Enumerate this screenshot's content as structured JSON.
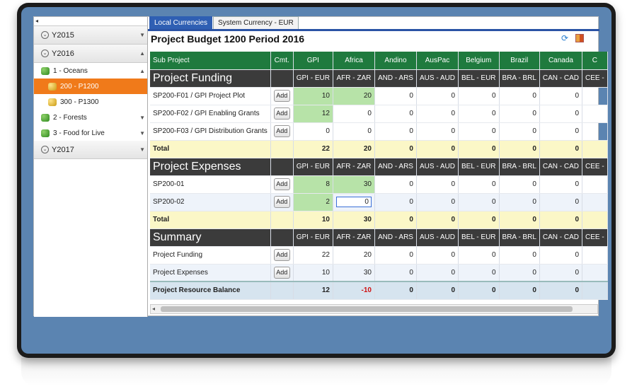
{
  "sidebar": {
    "collapse_glyph": "◂",
    "years": [
      {
        "label": "Y2015",
        "expanded": false
      },
      {
        "label": "Y2016",
        "expanded": true
      },
      {
        "label": "Y2017",
        "expanded": false
      }
    ],
    "nodes": [
      {
        "label": "1 - Oceans",
        "icon": "green-coins-icon",
        "level": 1,
        "selected": false
      },
      {
        "label": "200 - P1200",
        "icon": "gold-coins-icon",
        "level": 2,
        "selected": true
      },
      {
        "label": "300 - P1300",
        "icon": "gold-coins-icon",
        "level": 2,
        "selected": false
      },
      {
        "label": "2 - Forests",
        "icon": "green-coins-icon",
        "level": 1,
        "selected": false
      },
      {
        "label": "3 - Food for Live",
        "icon": "green-coins-icon",
        "level": 1,
        "selected": false
      }
    ]
  },
  "tabs": [
    {
      "label": "Local Currencies",
      "active": true
    },
    {
      "label": "System Currency - EUR",
      "active": false
    }
  ],
  "page_title": "Project Budget 1200 Period 2016",
  "grid": {
    "headers": [
      "Sub Project",
      "Cmt.",
      "GPI",
      "Africa",
      "Andino",
      "AusPac",
      "Belgium",
      "Brazil",
      "Canada",
      "C"
    ],
    "currencies": [
      "GPI - EUR",
      "AFR - ZAR",
      "AND - ARS",
      "AUS - AUD",
      "BEL - EUR",
      "BRA - BRL",
      "CAN - CAD",
      "CEE - "
    ],
    "add_label": "Add",
    "sections": [
      {
        "name": "Project Funding",
        "rows": [
          {
            "label": "SP200-F01 / GPI Project Plot",
            "values": [
              "10",
              "20",
              "0",
              "0",
              "0",
              "0",
              "0",
              ""
            ]
          },
          {
            "label": "SP200-F02 / GPI Enabling Grants",
            "values": [
              "12",
              "0",
              "0",
              "0",
              "0",
              "0",
              "0",
              ""
            ]
          },
          {
            "label": "SP200-F03 / GPI Distribution Grants",
            "values": [
              "0",
              "0",
              "0",
              "0",
              "0",
              "0",
              "0",
              ""
            ]
          }
        ],
        "total_label": "Total",
        "totals": [
          "22",
          "20",
          "0",
          "0",
          "0",
          "0",
          "0",
          ""
        ]
      },
      {
        "name": "Project Expenses",
        "rows": [
          {
            "label": "SP200-01",
            "values": [
              "8",
              "30",
              "0",
              "0",
              "0",
              "0",
              "0",
              ""
            ]
          },
          {
            "label": "SP200-02",
            "values": [
              "2",
              "0",
              "0",
              "0",
              "0",
              "0",
              "0",
              ""
            ]
          }
        ],
        "total_label": "Total",
        "totals": [
          "10",
          "30",
          "0",
          "0",
          "0",
          "0",
          "0",
          ""
        ]
      },
      {
        "name": "Summary",
        "rows": [
          {
            "label": "Project Funding",
            "values": [
              "22",
              "20",
              "0",
              "0",
              "0",
              "0",
              "0",
              ""
            ]
          },
          {
            "label": "Project Expenses",
            "values": [
              "10",
              "30",
              "0",
              "0",
              "0",
              "0",
              "0",
              ""
            ]
          }
        ]
      }
    ],
    "balance_label": "Project Resource Balance",
    "balance": [
      "12",
      "-10",
      "0",
      "0",
      "0",
      "0",
      "0",
      ""
    ]
  },
  "colors": {
    "header_green": "#1f7a3e",
    "section_dark": "#3b3b3b",
    "selected_orange": "#f07a1a",
    "tab_blue": "#2f5fb3",
    "negative": "#d01010"
  }
}
